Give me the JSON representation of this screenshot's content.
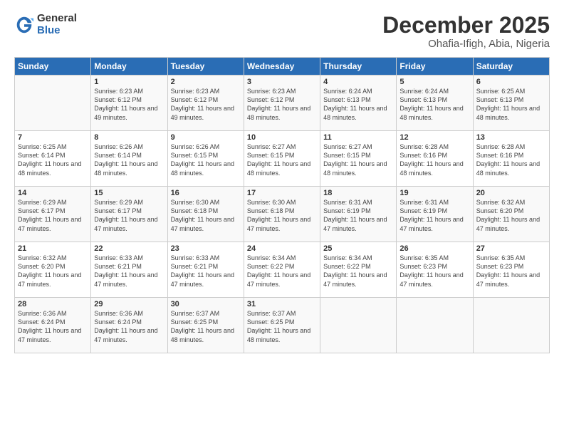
{
  "logo": {
    "general": "General",
    "blue": "Blue"
  },
  "header": {
    "month": "December 2025",
    "location": "Ohafia-Ifigh, Abia, Nigeria"
  },
  "days_of_week": [
    "Sunday",
    "Monday",
    "Tuesday",
    "Wednesday",
    "Thursday",
    "Friday",
    "Saturday"
  ],
  "weeks": [
    [
      {
        "day": "",
        "content": ""
      },
      {
        "day": "1",
        "content": "Sunrise: 6:23 AM\nSunset: 6:12 PM\nDaylight: 11 hours and 49 minutes."
      },
      {
        "day": "2",
        "content": "Sunrise: 6:23 AM\nSunset: 6:12 PM\nDaylight: 11 hours and 49 minutes."
      },
      {
        "day": "3",
        "content": "Sunrise: 6:23 AM\nSunset: 6:12 PM\nDaylight: 11 hours and 48 minutes."
      },
      {
        "day": "4",
        "content": "Sunrise: 6:24 AM\nSunset: 6:13 PM\nDaylight: 11 hours and 48 minutes."
      },
      {
        "day": "5",
        "content": "Sunrise: 6:24 AM\nSunset: 6:13 PM\nDaylight: 11 hours and 48 minutes."
      },
      {
        "day": "6",
        "content": "Sunrise: 6:25 AM\nSunset: 6:13 PM\nDaylight: 11 hours and 48 minutes."
      }
    ],
    [
      {
        "day": "7",
        "content": "Sunrise: 6:25 AM\nSunset: 6:14 PM\nDaylight: 11 hours and 48 minutes."
      },
      {
        "day": "8",
        "content": "Sunrise: 6:26 AM\nSunset: 6:14 PM\nDaylight: 11 hours and 48 minutes."
      },
      {
        "day": "9",
        "content": "Sunrise: 6:26 AM\nSunset: 6:15 PM\nDaylight: 11 hours and 48 minutes."
      },
      {
        "day": "10",
        "content": "Sunrise: 6:27 AM\nSunset: 6:15 PM\nDaylight: 11 hours and 48 minutes."
      },
      {
        "day": "11",
        "content": "Sunrise: 6:27 AM\nSunset: 6:15 PM\nDaylight: 11 hours and 48 minutes."
      },
      {
        "day": "12",
        "content": "Sunrise: 6:28 AM\nSunset: 6:16 PM\nDaylight: 11 hours and 48 minutes."
      },
      {
        "day": "13",
        "content": "Sunrise: 6:28 AM\nSunset: 6:16 PM\nDaylight: 11 hours and 48 minutes."
      }
    ],
    [
      {
        "day": "14",
        "content": "Sunrise: 6:29 AM\nSunset: 6:17 PM\nDaylight: 11 hours and 47 minutes."
      },
      {
        "day": "15",
        "content": "Sunrise: 6:29 AM\nSunset: 6:17 PM\nDaylight: 11 hours and 47 minutes."
      },
      {
        "day": "16",
        "content": "Sunrise: 6:30 AM\nSunset: 6:18 PM\nDaylight: 11 hours and 47 minutes."
      },
      {
        "day": "17",
        "content": "Sunrise: 6:30 AM\nSunset: 6:18 PM\nDaylight: 11 hours and 47 minutes."
      },
      {
        "day": "18",
        "content": "Sunrise: 6:31 AM\nSunset: 6:19 PM\nDaylight: 11 hours and 47 minutes."
      },
      {
        "day": "19",
        "content": "Sunrise: 6:31 AM\nSunset: 6:19 PM\nDaylight: 11 hours and 47 minutes."
      },
      {
        "day": "20",
        "content": "Sunrise: 6:32 AM\nSunset: 6:20 PM\nDaylight: 11 hours and 47 minutes."
      }
    ],
    [
      {
        "day": "21",
        "content": "Sunrise: 6:32 AM\nSunset: 6:20 PM\nDaylight: 11 hours and 47 minutes."
      },
      {
        "day": "22",
        "content": "Sunrise: 6:33 AM\nSunset: 6:21 PM\nDaylight: 11 hours and 47 minutes."
      },
      {
        "day": "23",
        "content": "Sunrise: 6:33 AM\nSunset: 6:21 PM\nDaylight: 11 hours and 47 minutes."
      },
      {
        "day": "24",
        "content": "Sunrise: 6:34 AM\nSunset: 6:22 PM\nDaylight: 11 hours and 47 minutes."
      },
      {
        "day": "25",
        "content": "Sunrise: 6:34 AM\nSunset: 6:22 PM\nDaylight: 11 hours and 47 minutes."
      },
      {
        "day": "26",
        "content": "Sunrise: 6:35 AM\nSunset: 6:23 PM\nDaylight: 11 hours and 47 minutes."
      },
      {
        "day": "27",
        "content": "Sunrise: 6:35 AM\nSunset: 6:23 PM\nDaylight: 11 hours and 47 minutes."
      }
    ],
    [
      {
        "day": "28",
        "content": "Sunrise: 6:36 AM\nSunset: 6:24 PM\nDaylight: 11 hours and 47 minutes."
      },
      {
        "day": "29",
        "content": "Sunrise: 6:36 AM\nSunset: 6:24 PM\nDaylight: 11 hours and 47 minutes."
      },
      {
        "day": "30",
        "content": "Sunrise: 6:37 AM\nSunset: 6:25 PM\nDaylight: 11 hours and 48 minutes."
      },
      {
        "day": "31",
        "content": "Sunrise: 6:37 AM\nSunset: 6:25 PM\nDaylight: 11 hours and 48 minutes."
      },
      {
        "day": "",
        "content": ""
      },
      {
        "day": "",
        "content": ""
      },
      {
        "day": "",
        "content": ""
      }
    ]
  ]
}
